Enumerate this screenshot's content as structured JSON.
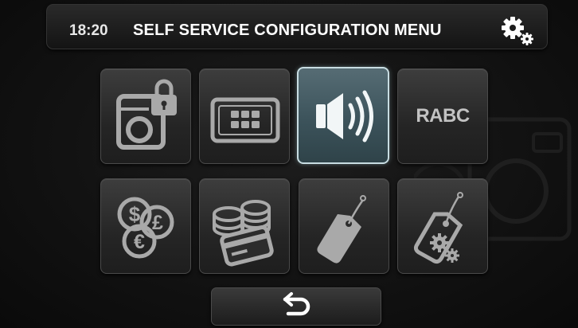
{
  "header": {
    "time": "18:20",
    "title": "SELF SERVICE CONFIGURATION MENU",
    "settings_icon": "gears-icon"
  },
  "menu": {
    "rows": [
      [
        {
          "icon": "machine-lock-icon",
          "active": false
        },
        {
          "icon": "keypad-icon",
          "active": false
        },
        {
          "icon": "speaker-icon",
          "active": true
        },
        {
          "icon": "rabc-text-icon",
          "label": "RABC",
          "active": false
        }
      ],
      [
        {
          "icon": "currency-icon",
          "active": false
        },
        {
          "icon": "coins-card-icon",
          "active": false
        },
        {
          "icon": "price-tag-icon",
          "active": false
        },
        {
          "icon": "tag-gears-icon",
          "active": false
        }
      ]
    ]
  },
  "footer": {
    "back_icon": "back-arrow-icon"
  },
  "colors": {
    "background": "#121212",
    "tile": "#2e2e2e",
    "tile_active": "#4a6068",
    "icon": "#a9a9a9",
    "text": "#ffffff"
  }
}
